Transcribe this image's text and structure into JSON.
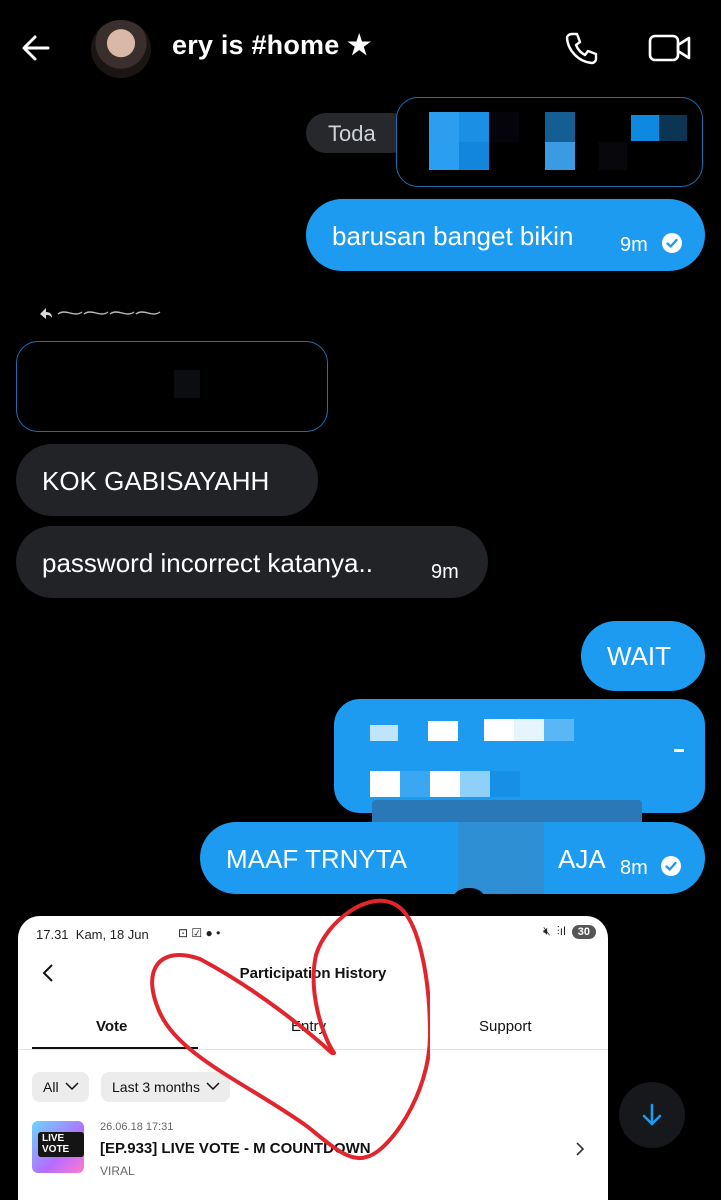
{
  "header": {
    "title": "ery is #home ★"
  },
  "messages": {
    "today_label": "Toda",
    "barusan": {
      "text": "barusan banget bikin",
      "time": "9m"
    },
    "kok": {
      "text": "KOK GABISAYAHH"
    },
    "password": {
      "text": "password incorrect katanya..",
      "time": "9m"
    },
    "wait": {
      "text": "WAIT"
    },
    "maaf": {
      "text_start": "MAAF TRNYTA",
      "text_end": "AJA",
      "time": "8m"
    }
  },
  "attachment": {
    "status_time": "17.31",
    "status_date": "Kam, 18 Jun",
    "battery": "30",
    "page_title": "Participation History",
    "tabs": [
      "Vote",
      "Entry",
      "Support"
    ],
    "filters": {
      "all": "All",
      "period": "Last 3 months"
    },
    "item": {
      "date": "26.06.18 17:31",
      "title": "[EP.933] LIVE VOTE - M COUNTDOWN",
      "category": "VIRAL",
      "thumb_text": "LIVE VOTE"
    }
  },
  "colors": {
    "sent_bubble": "#1d9bf0",
    "received_bubble": "#212327",
    "heart_stroke": "#e0262c"
  }
}
